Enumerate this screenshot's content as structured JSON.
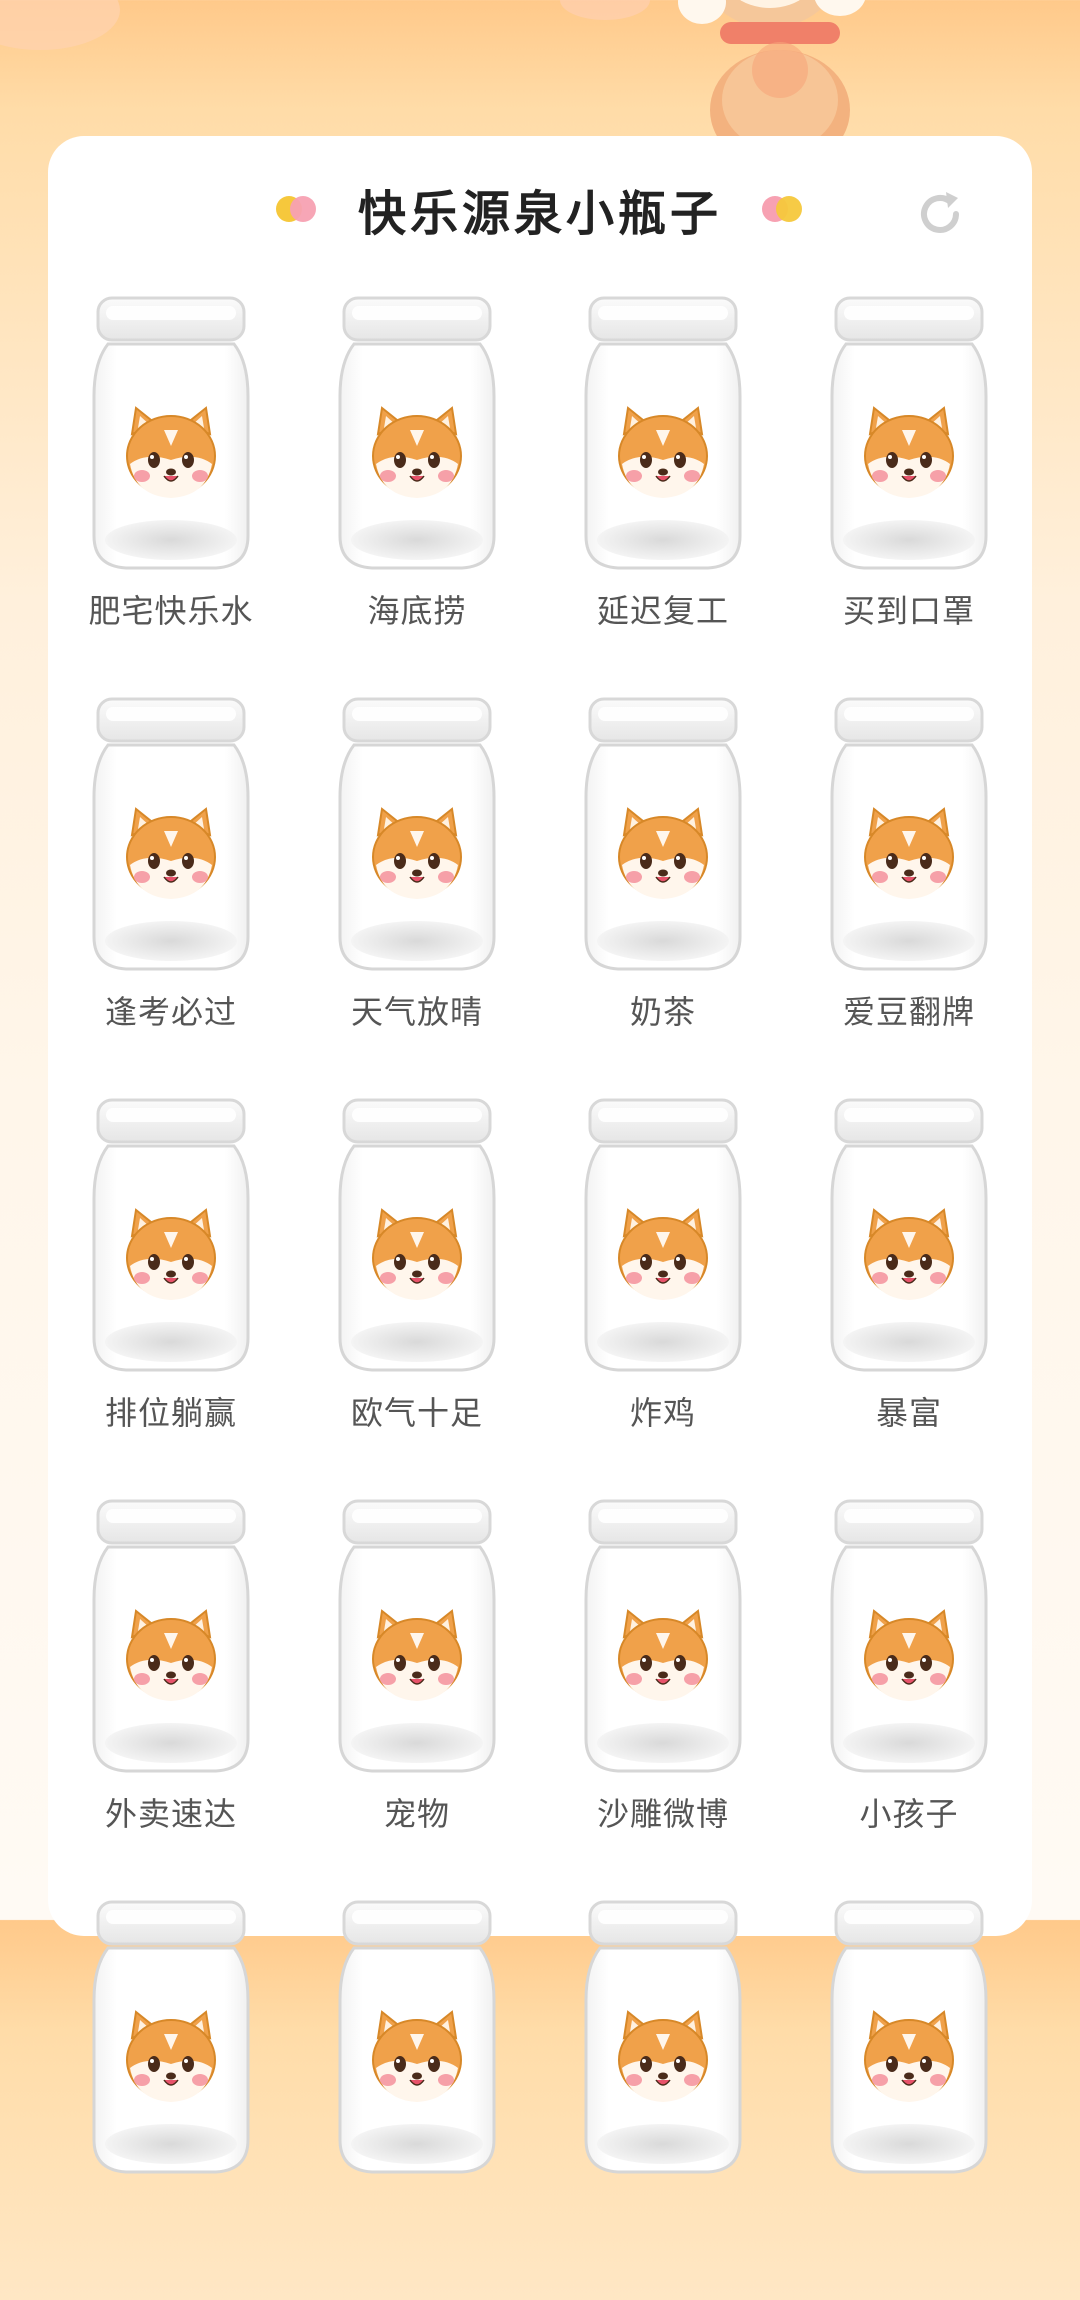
{
  "header": {
    "title": "快乐源泉小瓶子",
    "refresh_icon": "refresh-icon"
  },
  "colors": {
    "dot_yellow": "#f6c83c",
    "dot_pink": "#f7a1b2",
    "accent_orange": "#f0a14a"
  },
  "bottles": [
    {
      "label": "肥宅快乐水"
    },
    {
      "label": "海底捞"
    },
    {
      "label": "延迟复工"
    },
    {
      "label": "买到口罩"
    },
    {
      "label": "逢考必过"
    },
    {
      "label": "天气放晴"
    },
    {
      "label": "奶茶"
    },
    {
      "label": "爱豆翻牌"
    },
    {
      "label": "排位躺赢"
    },
    {
      "label": "欧气十足"
    },
    {
      "label": "炸鸡"
    },
    {
      "label": "暴富"
    },
    {
      "label": "外卖速达"
    },
    {
      "label": "宠物"
    },
    {
      "label": "沙雕微博"
    },
    {
      "label": "小孩子"
    },
    {
      "label": ""
    },
    {
      "label": ""
    },
    {
      "label": ""
    },
    {
      "label": ""
    }
  ]
}
